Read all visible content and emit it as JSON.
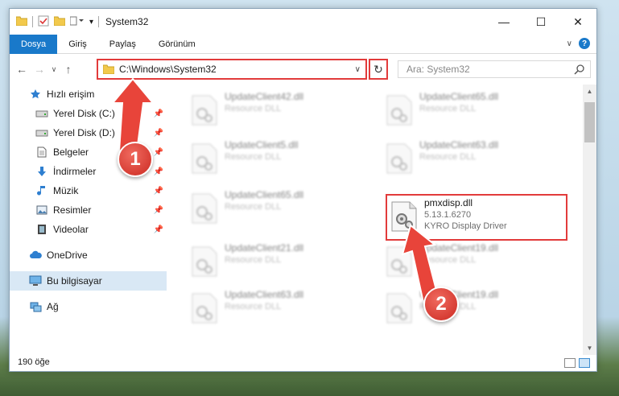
{
  "window": {
    "title": "System32",
    "controls": {
      "minimize": "—",
      "maximize": "☐",
      "close": "✕"
    }
  },
  "ribbon": {
    "tabs": [
      {
        "label": "Dosya"
      },
      {
        "label": "Giriş"
      },
      {
        "label": "Paylaş"
      },
      {
        "label": "Görünüm"
      }
    ],
    "help": "?"
  },
  "nav": {
    "address": "C:\\Windows\\System32",
    "search_placeholder": "Ara: System32"
  },
  "sidebar": {
    "items": [
      {
        "label": "Hızlı erişim"
      },
      {
        "label": "Yerel Disk (C:)"
      },
      {
        "label": "Yerel Disk (D:)"
      },
      {
        "label": "Belgeler"
      },
      {
        "label": "İndirmeler"
      },
      {
        "label": "Müzik"
      },
      {
        "label": "Resimler"
      },
      {
        "label": "Videolar"
      },
      {
        "label": "OneDrive"
      },
      {
        "label": "Bu bilgisayar"
      },
      {
        "label": "Ağ"
      }
    ]
  },
  "files": [
    {
      "name": "UpdateClient42.dll",
      "sub": "Resource DLL"
    },
    {
      "name": "UpdateClient65.dll",
      "sub": "Resource DLL"
    },
    {
      "name": "UpdateClient5.dll",
      "sub": "Resource DLL"
    },
    {
      "name": "UpdateClient63.dll",
      "sub": "Resource DLL"
    },
    {
      "name": "UpdateClient65.dll",
      "sub": "Resource DLL"
    },
    {
      "name": "pmxdisp.dll",
      "version": "5.13.1.6270",
      "sub": "KYRO Display Driver"
    },
    {
      "name": "UpdateClient21.dll",
      "sub": "Resource DLL"
    },
    {
      "name": "UpdateClient19.dll",
      "sub": "Resource DLL"
    },
    {
      "name": "UpdateClient63.dll",
      "sub": "Resource DLL"
    },
    {
      "name": "UpdateClient19.dll",
      "sub": "Resource DLL"
    }
  ],
  "status": {
    "count": "190 öğe"
  },
  "annotations": {
    "step1": "1",
    "step2": "2"
  },
  "colors": {
    "accent": "#1979ca",
    "annotation": "#e23b3b"
  }
}
